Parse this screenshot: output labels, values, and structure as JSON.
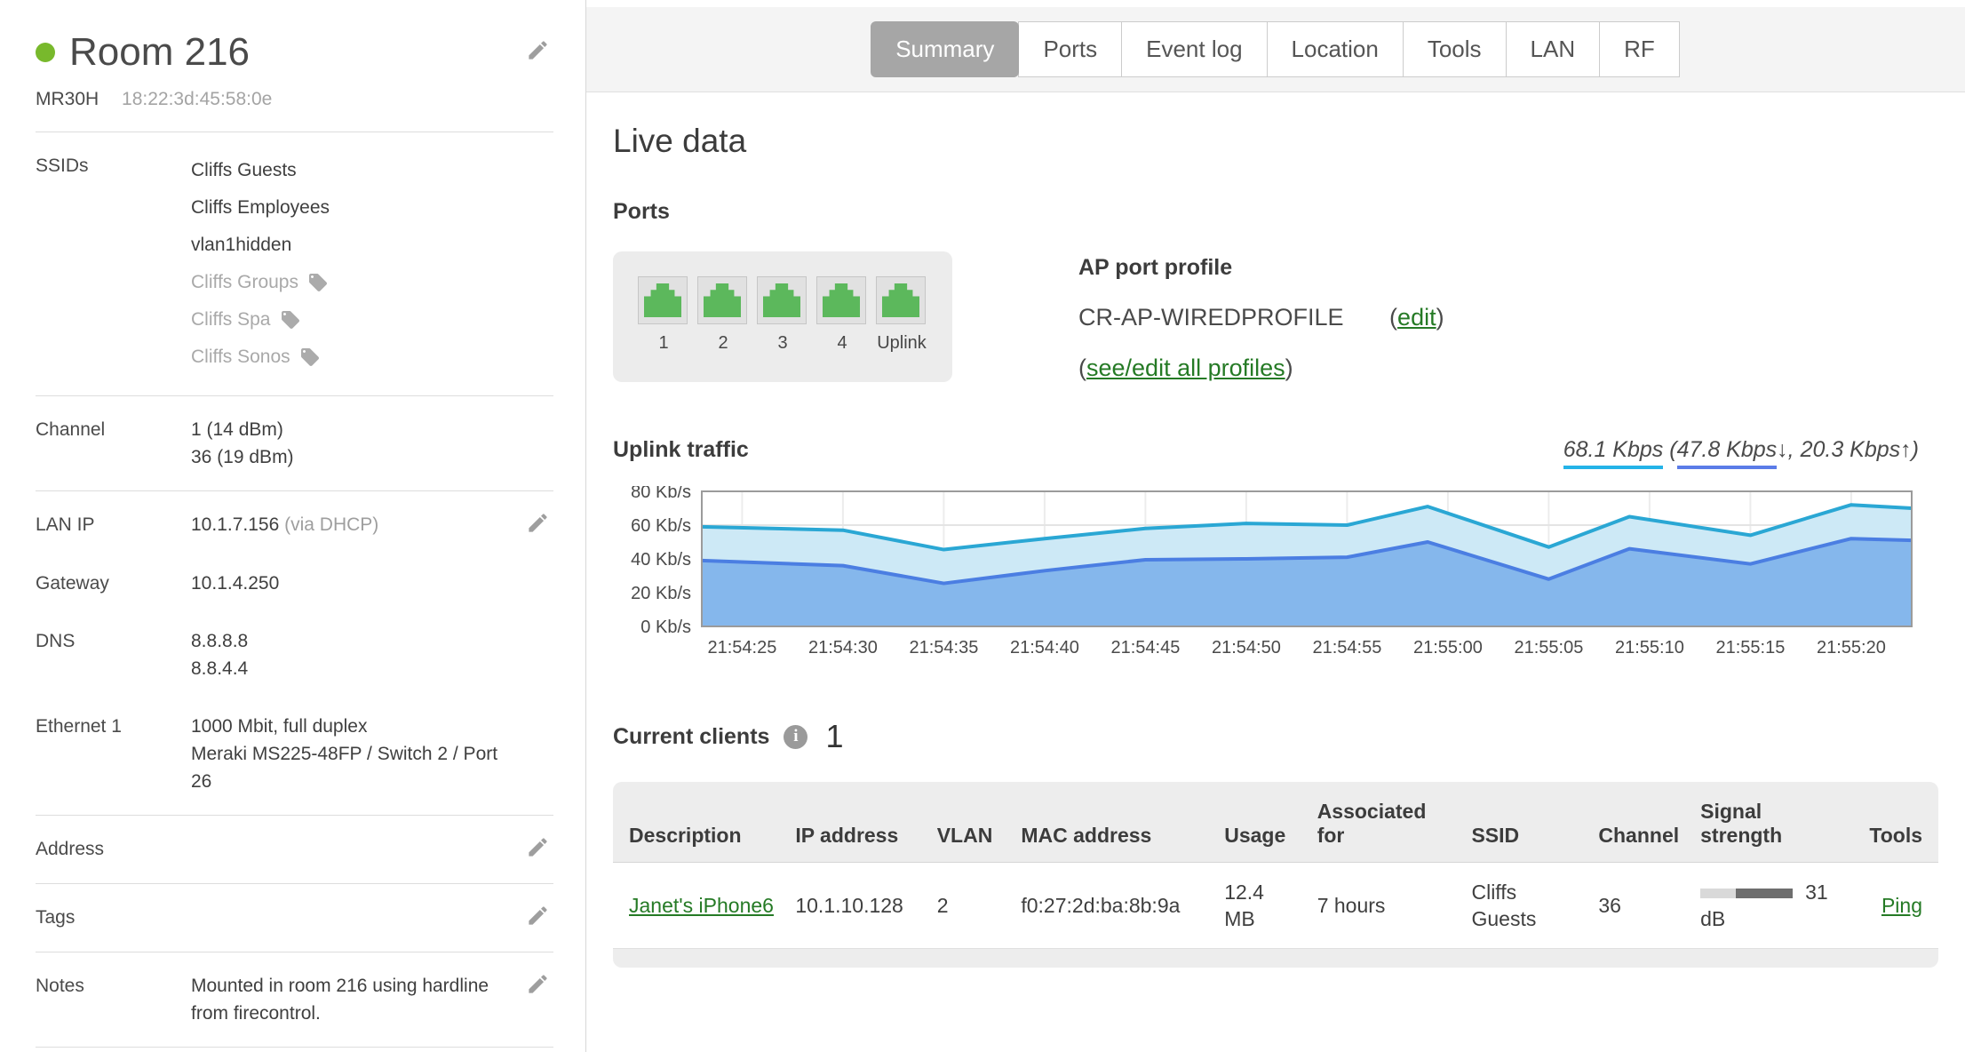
{
  "sidebar": {
    "device_name": "Room 216",
    "model": "MR30H",
    "mac": "18:22:3d:45:58:0e",
    "status": "online",
    "status_color": "#78b92c",
    "ssids": {
      "label": "SSIDs",
      "items": [
        {
          "name": "Cliffs Guests",
          "muted": false,
          "tagged": false
        },
        {
          "name": "Cliffs Employees",
          "muted": false,
          "tagged": false
        },
        {
          "name": "vlan1hidden",
          "muted": false,
          "tagged": false
        },
        {
          "name": "Cliffs Groups",
          "muted": true,
          "tagged": true
        },
        {
          "name": "Cliffs Spa",
          "muted": true,
          "tagged": true
        },
        {
          "name": "Cliffs Sonos",
          "muted": true,
          "tagged": true
        }
      ]
    },
    "channel": {
      "label": "Channel",
      "lines": [
        "1 (14 dBm)",
        "36 (19 dBm)"
      ]
    },
    "lan_ip": {
      "label": "LAN IP",
      "value": "10.1.7.156",
      "suffix": "(via DHCP)"
    },
    "gateway": {
      "label": "Gateway",
      "value": "10.1.4.250"
    },
    "dns": {
      "label": "DNS",
      "lines": [
        "8.8.8.8",
        "8.8.4.4"
      ]
    },
    "ethernet": {
      "label": "Ethernet 1",
      "lines": [
        "1000 Mbit, full duplex",
        "Meraki MS225-48FP / Switch 2 / Port 26"
      ]
    },
    "address": {
      "label": "Address",
      "value": ""
    },
    "tags": {
      "label": "Tags",
      "value": ""
    },
    "notes": {
      "label": "Notes",
      "value": "Mounted in room 216 using hardline from firecontrol."
    }
  },
  "tabs": {
    "items": [
      "Summary",
      "Ports",
      "Event log",
      "Location",
      "Tools",
      "LAN",
      "RF"
    ],
    "active": "Summary"
  },
  "main": {
    "title": "Live data",
    "ports": {
      "heading": "Ports",
      "labels": [
        "1",
        "2",
        "3",
        "4",
        "Uplink"
      ]
    },
    "profile": {
      "heading": "AP port profile",
      "name": "CR-AP-WIREDPROFILE",
      "open": "(",
      "edit": "edit",
      "close": ")",
      "all_open": "(",
      "all": "see/edit all profiles",
      "all_close": ")"
    },
    "uplink": {
      "heading": "Uplink traffic",
      "total": "68.1 Kbps",
      "open": " (",
      "down": "47.8 Kbps",
      "down_arrow": "↓, ",
      "up": "20.3 Kbps",
      "up_arrow": "↑)"
    },
    "clients": {
      "heading": "Current clients",
      "count": "1",
      "headers": [
        "Description",
        "IP address",
        "VLAN",
        "MAC address",
        "Usage",
        "Associated for",
        "SSID",
        "Channel",
        "Signal strength",
        "Tools"
      ],
      "row": {
        "description": "Janet's iPhone6",
        "ip": "10.1.10.128",
        "vlan": "2",
        "mac": "f0:27:2d:ba:8b:9a",
        "usage": "12.4 MB",
        "associated": "7 hours",
        "ssid": "Cliffs Guests",
        "channel": "36",
        "signal_db": "31 dB",
        "signal_fill_pct": 62,
        "tool": "Ping"
      }
    }
  },
  "chart_data": {
    "type": "area",
    "title": "Uplink traffic",
    "ylabel": "Kb/s",
    "ylim": [
      0,
      80
    ],
    "y_ticks": [
      0,
      20,
      40,
      60,
      80
    ],
    "y_tick_suffix": " Kb/s",
    "x_range_s": [
      0,
      60
    ],
    "x_ticks": [
      {
        "s": 2,
        "label": "21:54:25"
      },
      {
        "s": 7,
        "label": "21:54:30"
      },
      {
        "s": 12,
        "label": "21:54:35"
      },
      {
        "s": 17,
        "label": "21:54:40"
      },
      {
        "s": 22,
        "label": "21:54:45"
      },
      {
        "s": 27,
        "label": "21:54:50"
      },
      {
        "s": 32,
        "label": "21:54:55"
      },
      {
        "s": 37,
        "label": "21:55:00"
      },
      {
        "s": 42,
        "label": "21:55:05"
      },
      {
        "s": 47,
        "label": "21:55:10"
      },
      {
        "s": 52,
        "label": "21:55:15"
      },
      {
        "s": 57,
        "label": "21:55:20"
      }
    ],
    "series": [
      {
        "name": "total",
        "unit": "Kb/s",
        "line_color": "#2aa7d4",
        "fill_color": "#cde9f6",
        "points": [
          [
            0,
            59
          ],
          [
            7,
            57
          ],
          [
            12,
            45.5
          ],
          [
            17,
            52
          ],
          [
            22,
            58
          ],
          [
            27,
            61
          ],
          [
            32,
            60
          ],
          [
            36,
            71
          ],
          [
            42,
            47
          ],
          [
            46,
            65
          ],
          [
            52,
            54
          ],
          [
            57,
            72
          ],
          [
            60,
            70
          ]
        ]
      },
      {
        "name": "download",
        "unit": "Kb/s",
        "line_color": "#4b7ee2",
        "fill_color": "#85b7ec",
        "points": [
          [
            0,
            39
          ],
          [
            7,
            36
          ],
          [
            12,
            25.5
          ],
          [
            17,
            33
          ],
          [
            22,
            39.5
          ],
          [
            27,
            40
          ],
          [
            32,
            41
          ],
          [
            36,
            50
          ],
          [
            42,
            28
          ],
          [
            46,
            46
          ],
          [
            52,
            37
          ],
          [
            57,
            52
          ],
          [
            60,
            51
          ]
        ]
      }
    ],
    "legend": "none",
    "grid": true
  }
}
